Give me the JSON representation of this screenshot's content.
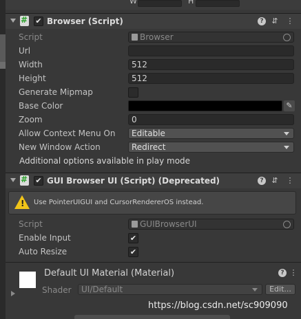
{
  "top": {
    "w_label": "W",
    "h_label": "H"
  },
  "browser": {
    "title": "Browser (Script)",
    "fields": {
      "script_label": "Script",
      "script_value": "Browser",
      "url_label": "Url",
      "url_value": "",
      "width_label": "Width",
      "width_value": "512",
      "height_label": "Height",
      "height_value": "512",
      "mipmap_label": "Generate Mipmap",
      "basecolor_label": "Base Color",
      "basecolor_value": "#000000",
      "zoom_label": "Zoom",
      "zoom_value": "0",
      "context_label": "Allow Context Menu On",
      "context_value": "Editable",
      "newwin_label": "New Window Action",
      "newwin_value": "Redirect"
    },
    "note": "Additional options available in play mode"
  },
  "gui": {
    "title": "GUI Browser UI (Script) (Deprecated)",
    "warning": "Use PointerUIGUI and CursorRendererOS instead.",
    "script_label": "Script",
    "script_value": "GUIBrowserUI",
    "enable_input_label": "Enable Input",
    "enable_input_value": true,
    "auto_resize_label": "Auto Resize",
    "auto_resize_value": true
  },
  "material": {
    "title": "Default UI Material (Material)",
    "shader_label": "Shader",
    "shader_value": "UI/Default",
    "edit_label": "Edit..."
  },
  "icons": {
    "script": "script-icon",
    "help": "help-icon",
    "settings": "preset-settings-icon",
    "menu": "context-menu-icon",
    "warning": "warning-icon",
    "picker": "eyedropper-icon"
  },
  "watermark": "https://blog.csdn.net/sc909090"
}
